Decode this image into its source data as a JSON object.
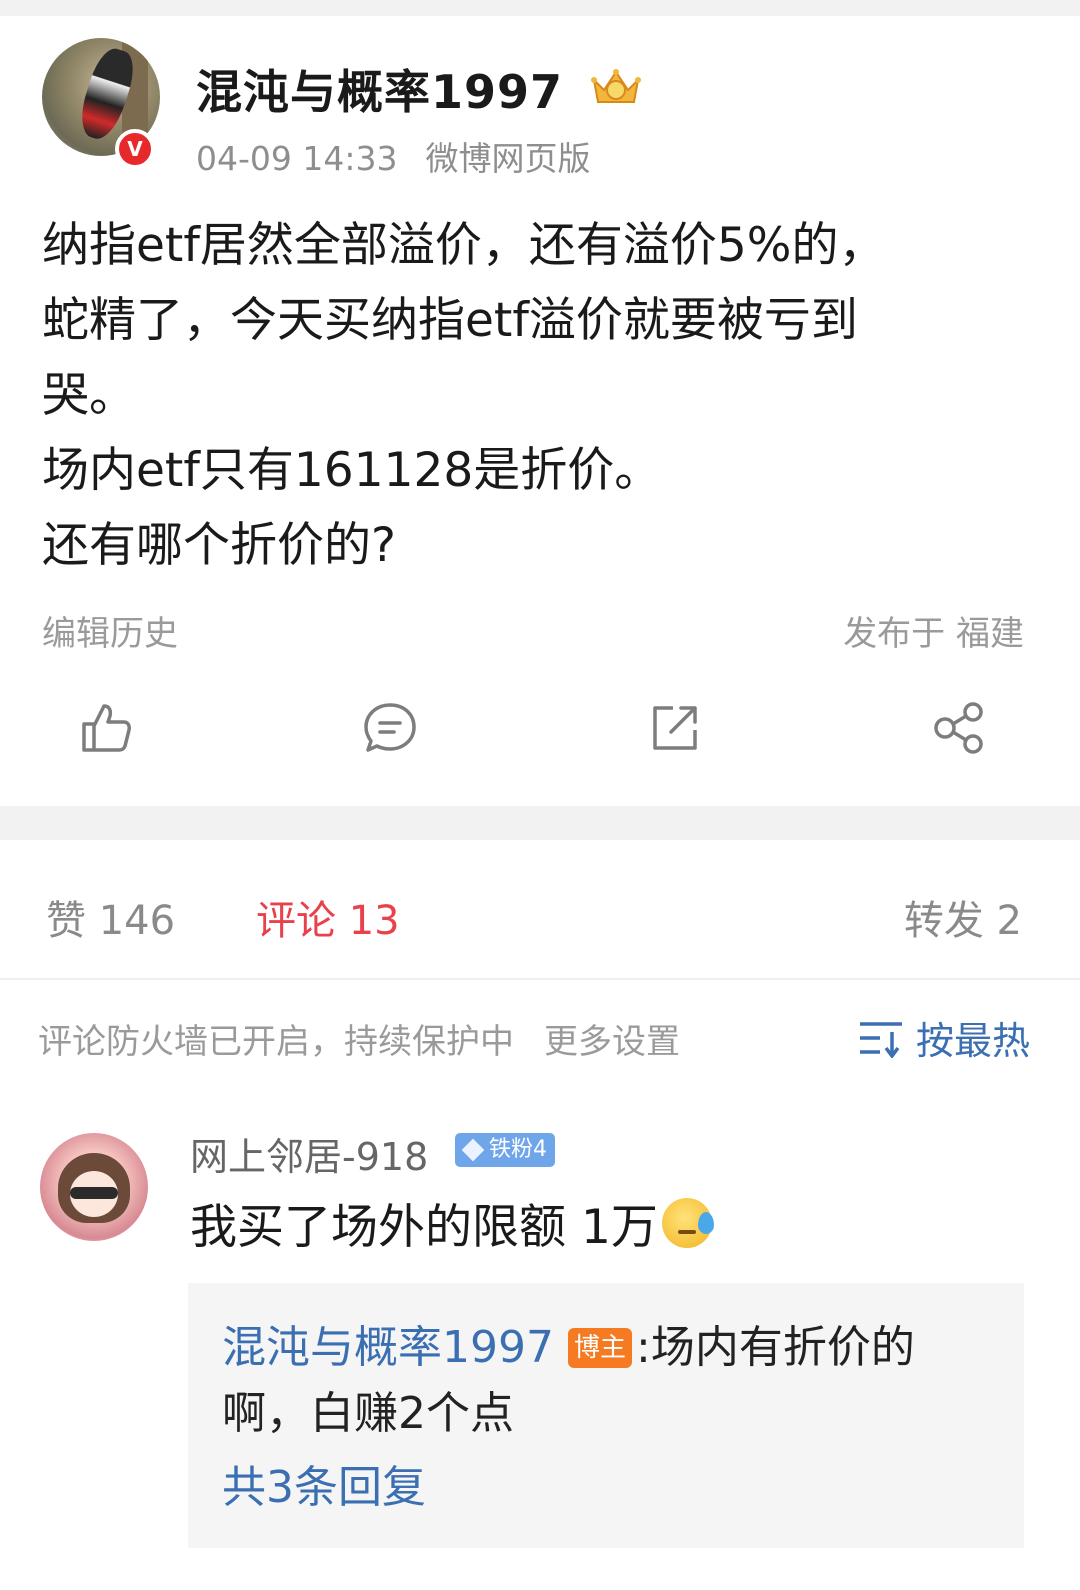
{
  "post": {
    "author": "混沌与概率1997",
    "verified_mark": "V",
    "time": "04-09 14:33",
    "source": "微博网页版",
    "text_lines": [
      "纳指etf居然全部溢价，还有溢价5%的，",
      "蛇精了，今天买纳指etf溢价就要被亏到",
      "哭。",
      "场内etf只有161128是折价。",
      "还有哪个折价的?"
    ],
    "edit_history": "编辑历史",
    "location": "发布于 福建",
    "icons": {
      "like": "thumbs-up-icon",
      "comment": "comment-bubble-icon",
      "repost": "repost-external-icon",
      "share": "share-nodes-icon",
      "crown": "crown-badge-icon"
    }
  },
  "stats": {
    "likes": "赞 146",
    "comments": "评论 13",
    "reposts": "转发 2"
  },
  "comment_bar": {
    "firewall": "评论防火墙已开启，持续保护中",
    "more_settings": "更多设置",
    "sort": "按最热"
  },
  "comment": {
    "user": "网上邻居-918",
    "badge": "铁粉4",
    "text": "我买了场外的限额 1万",
    "emoji": "sweat-emoji",
    "reply": {
      "user": "混沌与概率1997",
      "owner_badge": "博主",
      "colon": ":",
      "text_line1": " 场内有折价的",
      "text_line2": "啊，白赚2个点",
      "more": "共3条回复"
    }
  },
  "colors": {
    "accent_red": "#e8414b",
    "link_blue": "#3b6fb2",
    "owner_orange": "#f57a21",
    "fan_blue": "#6fa6ea"
  }
}
